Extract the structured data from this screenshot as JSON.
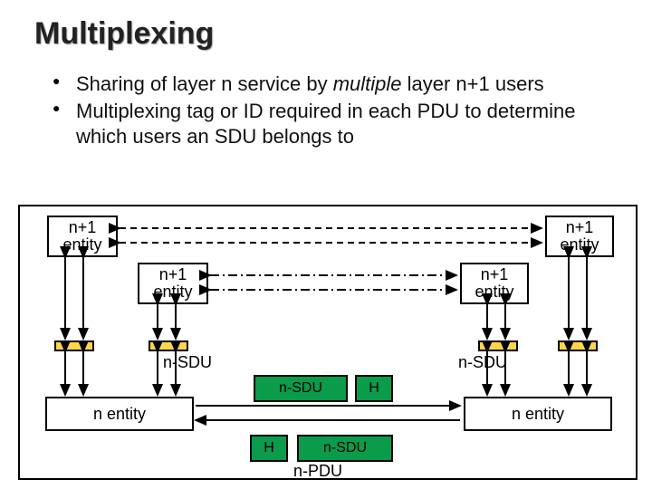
{
  "title": "Multiplexing",
  "bullets": [
    {
      "pre": "Sharing of layer n service by ",
      "em": "multiple",
      "post": " layer n+1 users"
    },
    {
      "pre": "Multiplexing tag or ID required in each PDU to determine which users an SDU belongs to",
      "em": "",
      "post": ""
    }
  ],
  "labels": {
    "np1_entity": "n+1\nentity",
    "n_entity": "n entity",
    "n_sdu": "n-SDU",
    "H": "H",
    "n_pdu": "n-PDU"
  }
}
